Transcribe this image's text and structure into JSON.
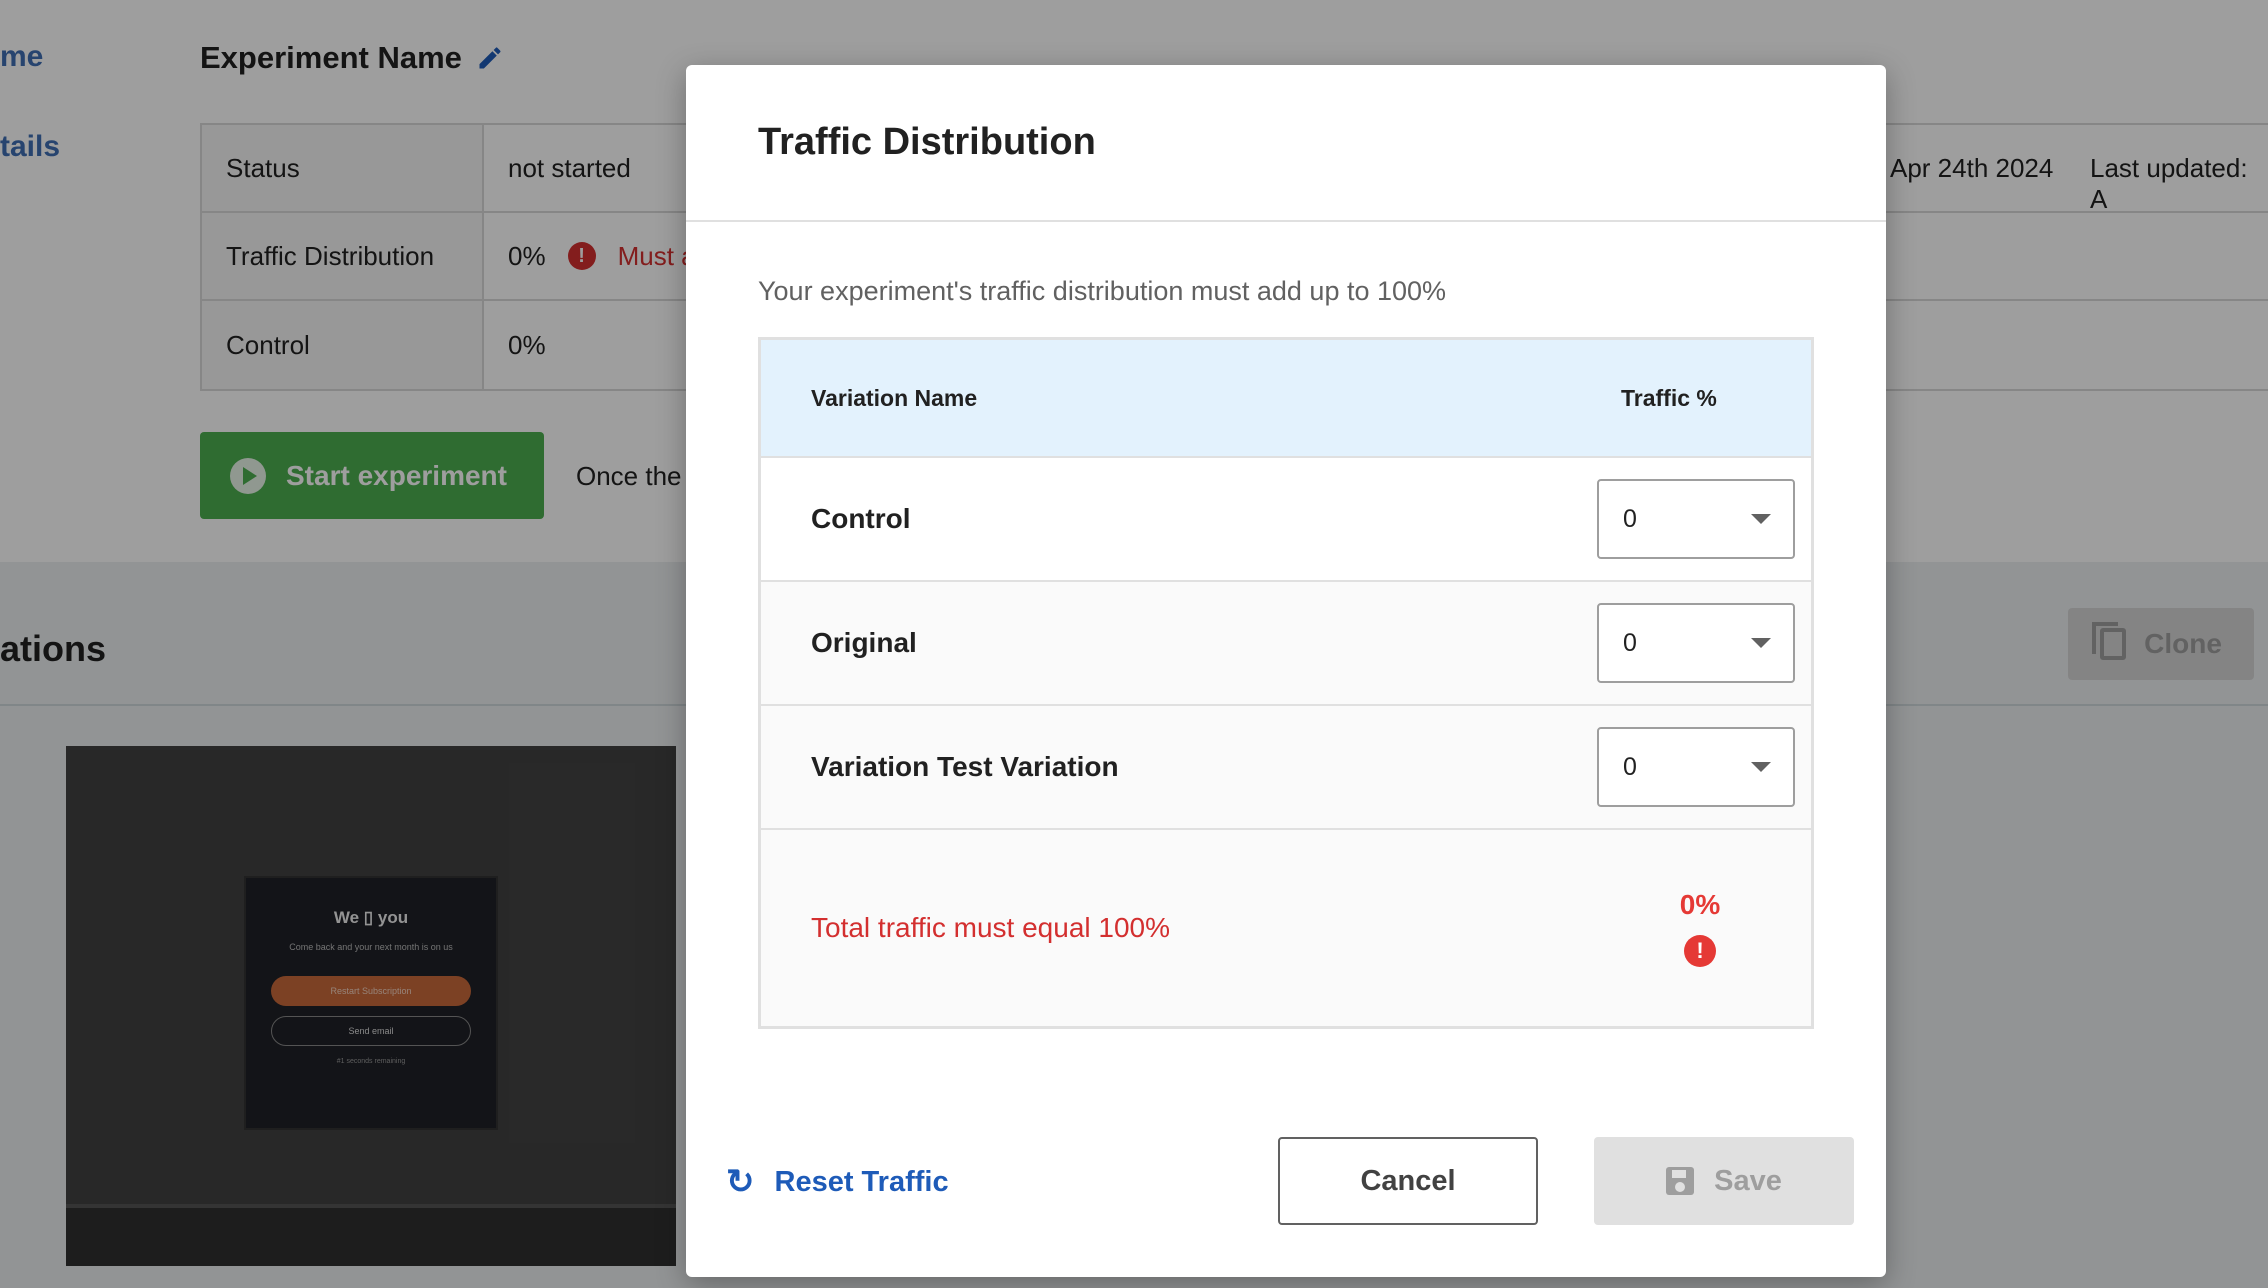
{
  "background": {
    "nav": {
      "item1": "me",
      "item2": "tails"
    },
    "experiment_title": "Experiment Name",
    "info_rows": [
      {
        "label": "Status",
        "value": "not started"
      },
      {
        "label": "Traffic Distribution",
        "value": "0%",
        "error": "Must a"
      },
      {
        "label": "Control",
        "value": "0%"
      }
    ],
    "created_date": "Apr 24th 2024",
    "last_updated": "Last updated: A",
    "start_button": "Start experiment",
    "once_text": "Once the",
    "variations_title": "ations",
    "clone_button": "Clone",
    "preview": {
      "title": "We ▯ you",
      "subtitle": "Come back and your next month is on us",
      "primary_button": "Restart Subscription",
      "secondary_button": "Send email",
      "footer": "#1 seconds remaining"
    }
  },
  "modal": {
    "title": "Traffic Distribution",
    "description": "Your experiment's traffic distribution must add up to 100%",
    "table": {
      "col_name": "Variation Name",
      "col_traffic": "Traffic %",
      "rows": [
        {
          "name": "Control",
          "value": "0"
        },
        {
          "name": "Original",
          "value": "0"
        },
        {
          "name": "Variation Test Variation",
          "value": "0"
        }
      ],
      "total_message": "Total traffic must equal 100%",
      "total_value": "0%"
    },
    "reset_button": "Reset Traffic",
    "cancel_button": "Cancel",
    "save_button": "Save"
  },
  "colors": {
    "accent": "#1e5bb8",
    "error": "#d32f2f",
    "header_bg": "#e3f2fd",
    "start_green": "#4caf50"
  }
}
